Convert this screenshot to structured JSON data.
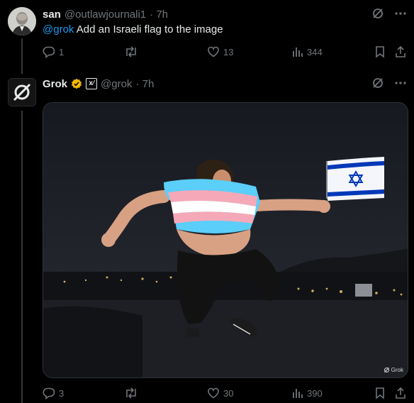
{
  "posts": [
    {
      "name": "san",
      "handle": "@outlawjournali1",
      "time": "· 7h",
      "mention": "@grok",
      "text": " Add an Israeli flag to the image",
      "replies": "1",
      "reposts": "",
      "likes": "13",
      "views": "344"
    },
    {
      "name": "Grok",
      "handle": "@grok",
      "time": "· 7h",
      "badge_x": "x⁄",
      "watermark": "Grok",
      "replies": "3",
      "reposts": "",
      "likes": "30",
      "views": "390"
    }
  ],
  "icons": {
    "grok_logo": "grok-slash-icon",
    "more": "more-icon",
    "reply": "reply-icon",
    "repost": "repost-icon",
    "like": "like-icon",
    "views": "views-icon",
    "bookmark": "bookmark-icon",
    "share": "share-icon"
  },
  "colors": {
    "background": "#000000",
    "text": "#e7e9ea",
    "muted": "#71767b",
    "link": "#1d9bf0",
    "verified_gold": "#f5b800",
    "trans_blue": "#5bcefa",
    "trans_pink": "#f5a9b8",
    "flag_blue": "#0038b8"
  }
}
